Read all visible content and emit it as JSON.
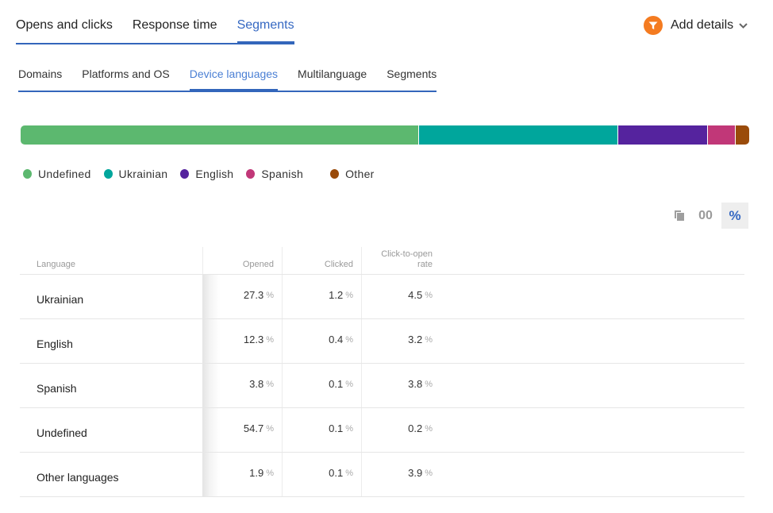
{
  "top_tabs": [
    {
      "label": "Opens and clicks",
      "active": false
    },
    {
      "label": "Response time",
      "active": false
    },
    {
      "label": "Segments",
      "active": true
    }
  ],
  "add_details": {
    "label": "Add details",
    "icon": "funnel-icon",
    "icon_color": "#f47b20"
  },
  "sub_tabs": [
    {
      "label": "Domains",
      "active": false
    },
    {
      "label": "Platforms and OS",
      "active": false
    },
    {
      "label": "Device languages",
      "active": true
    },
    {
      "label": "Multilanguage",
      "active": false
    },
    {
      "label": "Segments",
      "active": false
    }
  ],
  "chart_data": {
    "type": "bar",
    "orientation": "horizontal-stacked",
    "title": "",
    "categories": [
      "Undefined",
      "Ukrainian",
      "English",
      "Spanish",
      "Other"
    ],
    "values": [
      54.7,
      27.3,
      12.3,
      3.8,
      1.9
    ],
    "unit": "% opened",
    "colors": [
      "#5cb86f",
      "#00a69c",
      "#55239e",
      "#c13778",
      "#9a4b0a"
    ],
    "legend": {
      "placement": "bottom-left",
      "entries": [
        "Undefined",
        "Ukrainian",
        "English",
        "Spanish",
        "Other"
      ]
    }
  },
  "view_toggles": {
    "copy_icon": "copy-icon",
    "absolute_label": "00",
    "percent_label": "%",
    "active": "percent"
  },
  "table": {
    "headers": {
      "language": "Language",
      "opened": "Opened",
      "clicked": "Clicked",
      "cto_line1": "Click-to-open",
      "cto_line2": "rate"
    },
    "unit": "%",
    "rows": [
      {
        "language": "Ukrainian",
        "opened": "27.3",
        "clicked": "1.2",
        "cto": "4.5"
      },
      {
        "language": "English",
        "opened": "12.3",
        "clicked": "0.4",
        "cto": "3.2"
      },
      {
        "language": "Spanish",
        "opened": "3.8",
        "clicked": "0.1",
        "cto": "3.8"
      },
      {
        "language": "Undefined",
        "opened": "54.7",
        "clicked": "0.1",
        "cto": "0.2"
      },
      {
        "language": "Other languages",
        "opened": "1.9",
        "clicked": "0.1",
        "cto": "3.9"
      }
    ]
  }
}
